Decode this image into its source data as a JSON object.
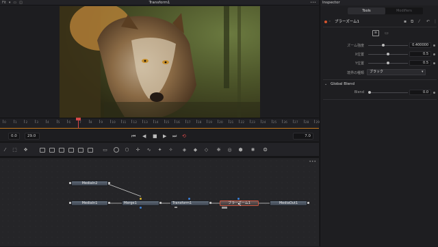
{
  "header": {
    "left_items": [
      "Fit",
      "▾"
    ],
    "title": "Transform1"
  },
  "viewer": {
    "image_subject": "wolf photo"
  },
  "timeline": {
    "ticks": [
      "0",
      "1",
      "2",
      "3",
      "4",
      "5",
      "6",
      "7",
      "8",
      "9",
      "10",
      "11",
      "12",
      "13",
      "14",
      "15",
      "16",
      "17",
      "18",
      "19",
      "20",
      "21",
      "22",
      "23",
      "24",
      "25",
      "26",
      "27",
      "28",
      "29"
    ],
    "current_frame": 7,
    "start": "0.0",
    "end": "29.0",
    "current_display": "7.0"
  },
  "nodes": {
    "items": [
      {
        "label": "MediaIn2"
      },
      {
        "label": "MediaIn1"
      },
      {
        "label": "Merge1"
      },
      {
        "label": "Transform1"
      },
      {
        "label": "ブラーズーム1"
      },
      {
        "label": "MediaOut1"
      }
    ]
  },
  "inspector": {
    "title": "Inspector",
    "tabs": [
      "Tools",
      "Modifiers"
    ],
    "tool_name": "ブラーズーム1",
    "params": [
      {
        "label": "ズーム強度",
        "value": "0.400000"
      },
      {
        "label": "X位置",
        "value": "0.5"
      },
      {
        "label": "Y位置",
        "value": "0.5"
      }
    ],
    "edge_label": "境界の種類",
    "edge_value": "ブラック",
    "global_blend_title": "Global Blend",
    "blend_label": "Blend",
    "blend_value": "0.0"
  },
  "colors": {
    "accent_orange": "#c67a1d",
    "playhead": "#d64848",
    "selected_node_border": "#c9543f"
  }
}
